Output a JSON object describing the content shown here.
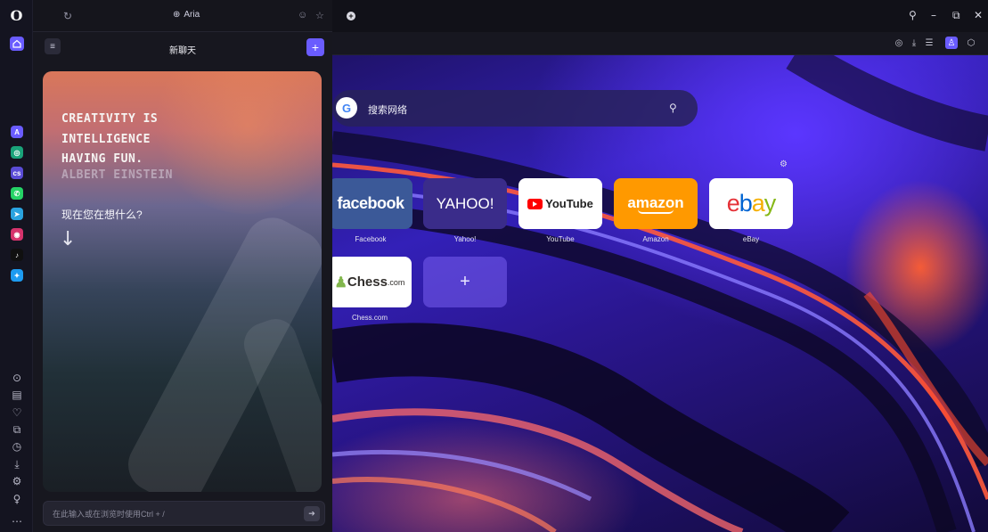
{
  "browser": {
    "logo": "O",
    "colors": {
      "accent": "#6a5cff",
      "sidebar_bg": "#141420"
    }
  },
  "sidebar": {
    "home_icon": "home-icon",
    "apps": [
      {
        "name": "aria",
        "icon": "aria-icon",
        "color": "#6a5cff",
        "glyph": "A"
      },
      {
        "name": "chatgpt",
        "icon": "chatgpt-icon",
        "color": "#1aa37a",
        "glyph": "◎"
      },
      {
        "name": "chatsonic",
        "icon": "chatsonic-icon",
        "color": "#5a4cd6",
        "glyph": "cs"
      },
      {
        "name": "whatsapp",
        "icon": "whatsapp-icon",
        "color": "#25d366",
        "glyph": "✆"
      },
      {
        "name": "telegram",
        "icon": "telegram-icon",
        "color": "#2aa3e0",
        "glyph": "➤"
      },
      {
        "name": "instagram",
        "icon": "instagram-icon",
        "color": "#d6336c",
        "glyph": "◉"
      },
      {
        "name": "tiktok",
        "icon": "tiktok-icon",
        "color": "#101010",
        "glyph": "♪"
      },
      {
        "name": "twitter",
        "icon": "twitter-icon",
        "color": "#1d9bf0",
        "glyph": "✦"
      }
    ],
    "tools": [
      {
        "name": "player",
        "icon": "play-circle-icon",
        "glyph": "⊙"
      },
      {
        "name": "pinboards",
        "icon": "pinboard-icon",
        "glyph": "▤"
      },
      {
        "name": "favorites",
        "icon": "heart-icon",
        "glyph": "♡"
      },
      {
        "name": "tabs",
        "icon": "tabs-icon",
        "glyph": "⧉"
      },
      {
        "name": "history",
        "icon": "clock-icon",
        "glyph": "◷"
      },
      {
        "name": "downloads",
        "icon": "download-icon",
        "glyph": "⤓"
      },
      {
        "name": "settings",
        "icon": "gear-icon",
        "glyph": "⚙"
      },
      {
        "name": "tips",
        "icon": "lightbulb-icon",
        "glyph": "♀"
      },
      {
        "name": "more",
        "icon": "more-icon",
        "glyph": "…"
      }
    ]
  },
  "aria_panel": {
    "tab_title": "Aria",
    "header_title": "新聊天",
    "quote_lines": [
      "CREATIVITY IS",
      "INTELLIGENCE",
      "HAVING FUN."
    ],
    "quote_author": "ALBERT EINSTEIN",
    "prompt_question": "现在您在想什么?",
    "input_placeholder": "在此输入或在浏览时使用Ctrl + /"
  },
  "speed_dial": {
    "search_placeholder": "搜索网络",
    "tiles": [
      {
        "name": "facebook",
        "logo": "facebook",
        "label": "Facebook"
      },
      {
        "name": "yahoo",
        "logo": "YAHOO!",
        "label": "Yahoo!"
      },
      {
        "name": "youtube",
        "logo": "YouTube",
        "label": "YouTube"
      },
      {
        "name": "amazon",
        "logo": "amazon",
        "label": "Amazon"
      },
      {
        "name": "ebay",
        "logo": "ebay",
        "label": "eBay"
      },
      {
        "name": "chess",
        "logo": "Chess",
        "logo_suffix": ".com",
        "label": "Chess.com"
      }
    ],
    "add_tile": "+"
  }
}
